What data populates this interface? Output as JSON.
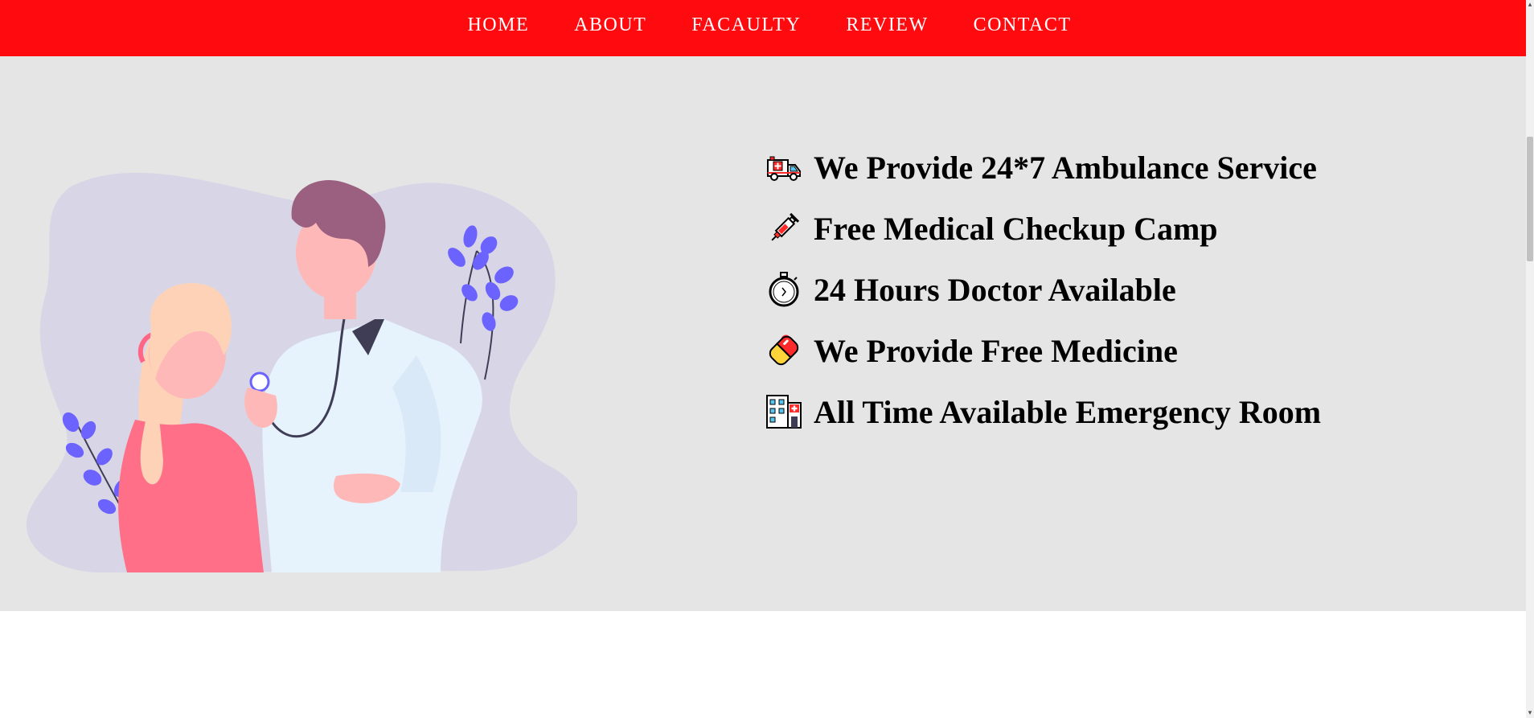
{
  "nav": {
    "items": [
      {
        "label": "HOME"
      },
      {
        "label": "ABOUT"
      },
      {
        "label": "FACAULTY"
      },
      {
        "label": "REVIEW"
      },
      {
        "label": "CONTACT"
      }
    ]
  },
  "services": [
    {
      "icon": "ambulance-icon",
      "text": "We Provide 24*7 Ambulance Service"
    },
    {
      "icon": "syringe-icon",
      "text": "Free Medical Checkup Camp"
    },
    {
      "icon": "stopwatch-icon",
      "text": "24 Hours Doctor Available"
    },
    {
      "icon": "pill-icon",
      "text": "We Provide Free Medicine"
    },
    {
      "icon": "hospital-icon",
      "text": "All Time Available Emergency Room"
    }
  ],
  "colors": {
    "navbar": "#ff0a0e",
    "hero_background": "#e5e5e5",
    "accent_purple": "#6c63ff",
    "blob": "#d8d6e6"
  }
}
